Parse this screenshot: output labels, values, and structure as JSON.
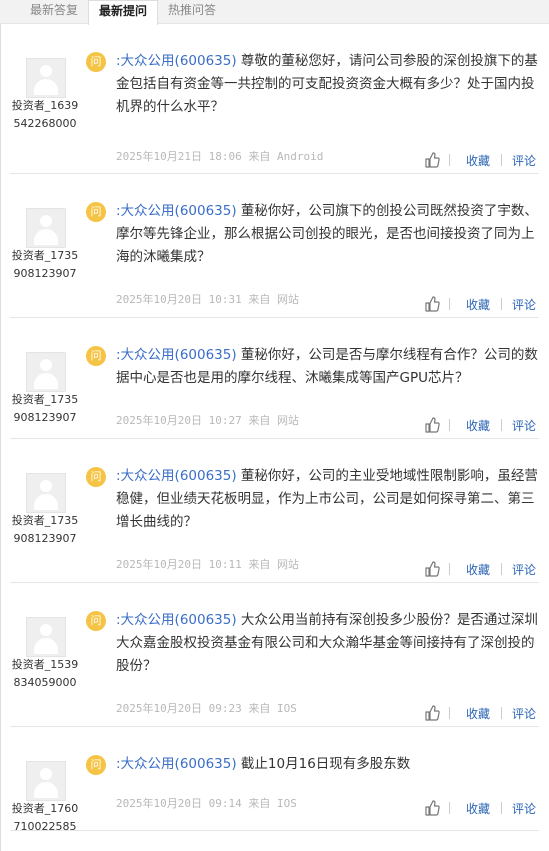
{
  "tabs": [
    "最新答复",
    "最新提问",
    "热推问答"
  ],
  "badge_label": "问",
  "like_label": "收藏",
  "comment_label": "评论",
  "items": [
    {
      "user_line1": "投资者_1639",
      "user_line2": "542268000",
      "company": ":大众公用(600635)",
      "question": "尊敬的董秘您好，请问公司参股的深创投旗下的基金包括自有资金等一共控制的可支配投资资金大概有多少？处于国内投机界的什么水平？",
      "meta": "2025年10月21日 18:06 来自 Android"
    },
    {
      "user_line1": "投资者_1735",
      "user_line2": "908123907",
      "company": ":大众公用(600635)",
      "question": "董秘你好，公司旗下的创投公司既然投资了宇数、摩尔等先锋企业，那么根据公司创投的眼光，是否也间接投资了同为上海的沐曦集成？",
      "meta": "2025年10月20日 10:31 来自 网站"
    },
    {
      "user_line1": "投资者_1735",
      "user_line2": "908123907",
      "company": ":大众公用(600635)",
      "question": "董秘你好，公司是否与摩尔线程有合作？公司的数据中心是否也是用的摩尔线程、沐曦集成等国产GPU芯片？",
      "meta": "2025年10月20日 10:27 来自 网站"
    },
    {
      "user_line1": "投资者_1735",
      "user_line2": "908123907",
      "company": ":大众公用(600635)",
      "question": "董秘你好，公司的主业受地域性限制影响，虽经营稳健，但业绩天花板明显，作为上市公司，公司是如何探寻第二、第三增长曲线的？",
      "meta": "2025年10月20日 10:11 来自 网站"
    },
    {
      "user_line1": "投资者_1539",
      "user_line2": "834059000",
      "company": ":大众公用(600635)",
      "question": "大众公用当前持有深创投多少股份？是否通过深圳大众嘉金股权投资基金有限公司和大众瀚华基金等间接持有了深创投的股份？",
      "meta": "2025年10月20日 09:23 来自 IOS"
    },
    {
      "user_line1": "投资者_1760",
      "user_line2": "710022585",
      "company": ":大众公用(600635)",
      "question": "截止10月16日现有多股东数",
      "meta": "2025年10月20日 09:14 来自 IOS"
    }
  ]
}
